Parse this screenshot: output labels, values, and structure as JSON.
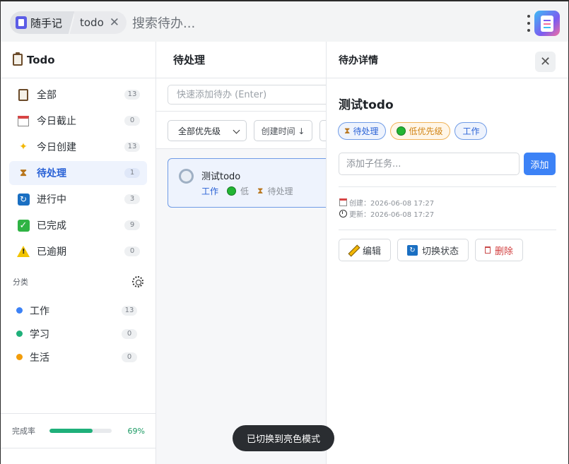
{
  "topbar": {
    "app_name": "随手记",
    "tab_label": "todo",
    "tab_close": "✕",
    "search_placeholder": "搜索待办..."
  },
  "sidebar": {
    "title": "Todo",
    "nav": [
      {
        "label": "全部",
        "count": "13",
        "icon": "clipboard-icon"
      },
      {
        "label": "今日截止",
        "count": "0",
        "icon": "calendar-icon"
      },
      {
        "label": "今日创建",
        "count": "13",
        "icon": "sparkle-icon"
      },
      {
        "label": "待处理",
        "count": "1",
        "icon": "hourglass-icon",
        "active": true
      },
      {
        "label": "进行中",
        "count": "3",
        "icon": "cycle-icon"
      },
      {
        "label": "已完成",
        "count": "9",
        "icon": "check-icon"
      },
      {
        "label": "已逾期",
        "count": "0",
        "icon": "warning-icon"
      }
    ],
    "categories_label": "分类",
    "categories": [
      {
        "label": "工作",
        "count": "13",
        "color": "#3c82f6"
      },
      {
        "label": "学习",
        "count": "0",
        "color": "#1fb07a"
      },
      {
        "label": "生活",
        "count": "0",
        "color": "#f29d0b"
      }
    ],
    "completion_label": "完成率",
    "completion_pct": "69%",
    "completion_value": 0.69
  },
  "list": {
    "title": "待处理",
    "quick_add_placeholder": "快速添加待办 (Enter)",
    "priority_filter": "全部优先级",
    "sort_label": "创建时间 ↓",
    "items": [
      {
        "title": "测试todo",
        "category": "工作",
        "priority": "低",
        "status": "待处理"
      }
    ]
  },
  "detail": {
    "header": "待办详情",
    "title": "测试todo",
    "status_tag": "待处理",
    "priority_tag": "低优先级",
    "category_tag": "工作",
    "subtask_placeholder": "添加子任务...",
    "add_label": "添加",
    "created": "创建：2026-06-08 17:27",
    "updated": "更新：2026-06-08 17:27",
    "edit_label": "编辑",
    "toggle_label": "切换状态",
    "delete_label": "删除"
  },
  "toast": "已切换到亮色模式"
}
